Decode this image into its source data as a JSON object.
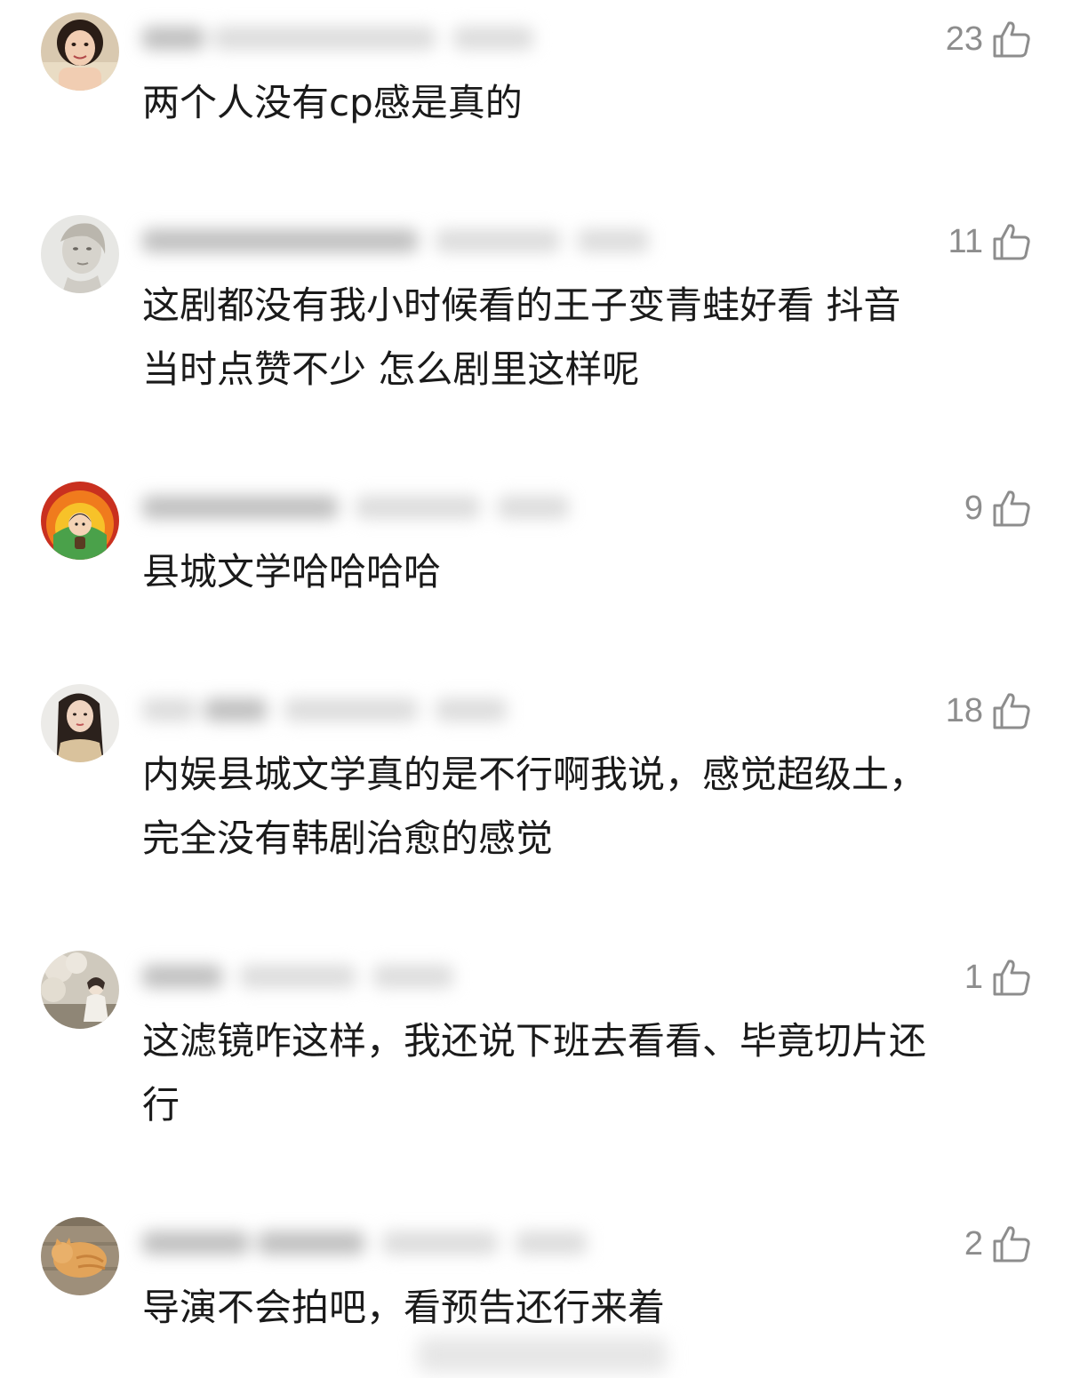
{
  "comments": [
    {
      "text": "两个人没有cp感是真的",
      "likes": "23",
      "avatar_icon": "avatar-woman-smiling"
    },
    {
      "text": "这剧都没有我小时候看的王子变青蛙好看 抖音\n当时点赞不少 怎么剧里这样呢",
      "likes": "11",
      "avatar_icon": "avatar-woman-sketch"
    },
    {
      "text": "县城文学哈哈哈哈",
      "likes": "9",
      "avatar_icon": "avatar-cartoon-explosion"
    },
    {
      "text": "内娱县城文学真的是不行啊我说，感觉超级土，\n完全没有韩剧治愈的感觉",
      "likes": "18",
      "avatar_icon": "avatar-woman-long-hair"
    },
    {
      "text": "这滤镜咋这样，我还说下班去看看、毕竟切片还\n行",
      "likes": "1",
      "avatar_icon": "avatar-blossom-photo"
    },
    {
      "text": "导演不会拍吧，看预告还行来着",
      "likes": "2",
      "avatar_icon": "avatar-sleeping-cat"
    }
  ],
  "like_icon": "thumbs-up-icon",
  "colors": {
    "text": "#1a1a1a",
    "like_count": "#8d8d8d",
    "background": "#ffffff"
  }
}
